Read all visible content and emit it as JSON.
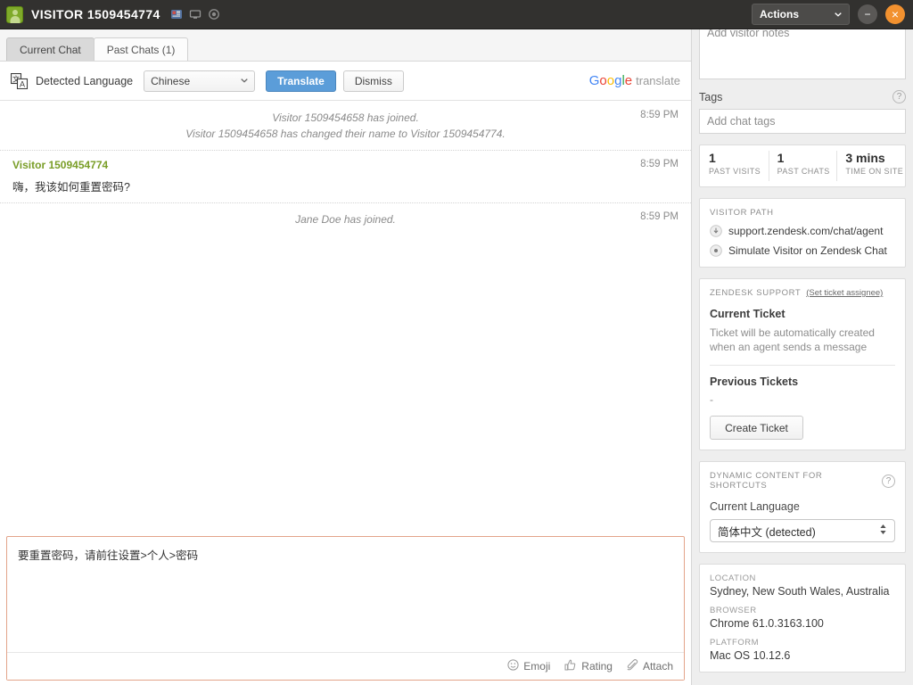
{
  "header": {
    "visitor_title": "VISITOR 1509454774",
    "icons": [
      "monitor-chart-icon",
      "desktop-icon",
      "clock-icon"
    ],
    "actions_label": "Actions",
    "minimize_label": "−",
    "close_label": "×",
    "bg_color": "#32312f",
    "close_color": "#f2912f"
  },
  "tabs": [
    {
      "label": "Current Chat",
      "active": true
    },
    {
      "label": "Past Chats (1)",
      "active": false
    }
  ],
  "translate_bar": {
    "detected_label": "Detected Language",
    "language_value": "Chinese",
    "translate_label": "Translate",
    "dismiss_label": "Dismiss",
    "google_letters": [
      "G",
      "o",
      "o",
      "g",
      "l",
      "e"
    ],
    "google_suffix": "translate",
    "accent_color": "#5b9dd9"
  },
  "transcript": [
    {
      "type": "system",
      "text": "Visitor 1509454658 has joined.",
      "time": "8:59 PM"
    },
    {
      "type": "system",
      "text": "Visitor 1509454658 has changed their name to Visitor 1509454774.",
      "time": ""
    },
    {
      "type": "message",
      "author": "Visitor 1509454774",
      "text": "嗨，我该如何重置密码?",
      "time": "8:59 PM"
    },
    {
      "type": "system",
      "text": "Jane Doe has joined.",
      "time": "8:59 PM"
    }
  ],
  "composer": {
    "value": "要重置密码，请前往设置>个人>密码",
    "placeholder": "",
    "tools": [
      {
        "icon": "smiley-icon",
        "label": "Emoji"
      },
      {
        "icon": "thumbs-up-icon",
        "label": "Rating"
      },
      {
        "icon": "paperclip-icon",
        "label": "Attach"
      }
    ],
    "border_color": "#e3a48a"
  },
  "sidebar": {
    "notes_placeholder": "Add visitor notes",
    "tags": {
      "title": "Tags",
      "help_icon": "question-mark-icon",
      "input_placeholder": "Add chat tags"
    },
    "stats": [
      {
        "value": "1",
        "label": "PAST VISITS"
      },
      {
        "value": "1",
        "label": "PAST CHATS"
      },
      {
        "value": "3 mins",
        "label": "TIME ON SITE"
      }
    ],
    "visitor_path": {
      "caption": "VISITOR PATH",
      "items": [
        {
          "icon": "download-circle-icon",
          "label": "support.zendesk.com/chat/agent"
        },
        {
          "icon": "dot-circle-icon",
          "label": "Simulate Visitor on Zendesk Chat"
        }
      ]
    },
    "zendesk_support": {
      "caption": "ZENDESK SUPPORT",
      "assignee_link": "(Set ticket assignee)",
      "current_ticket_title": "Current Ticket",
      "current_ticket_body": "Ticket will be automatically created when an agent sends a message",
      "previous_tickets_title": "Previous Tickets",
      "previous_tickets_value": "-",
      "create_ticket_label": "Create Ticket"
    },
    "dynamic_content": {
      "caption": "DYNAMIC CONTENT FOR SHORTCUTS",
      "help_icon": "question-mark-icon",
      "current_language_label": "Current Language",
      "current_language_value": "简体中文 (detected)"
    },
    "meta": [
      {
        "caption": "LOCATION",
        "value": "Sydney, New South Wales, Australia"
      },
      {
        "caption": "BROWSER",
        "value": "Chrome 61.0.3163.100"
      },
      {
        "caption": "PLATFORM",
        "value": "Mac OS 10.12.6"
      }
    ]
  }
}
